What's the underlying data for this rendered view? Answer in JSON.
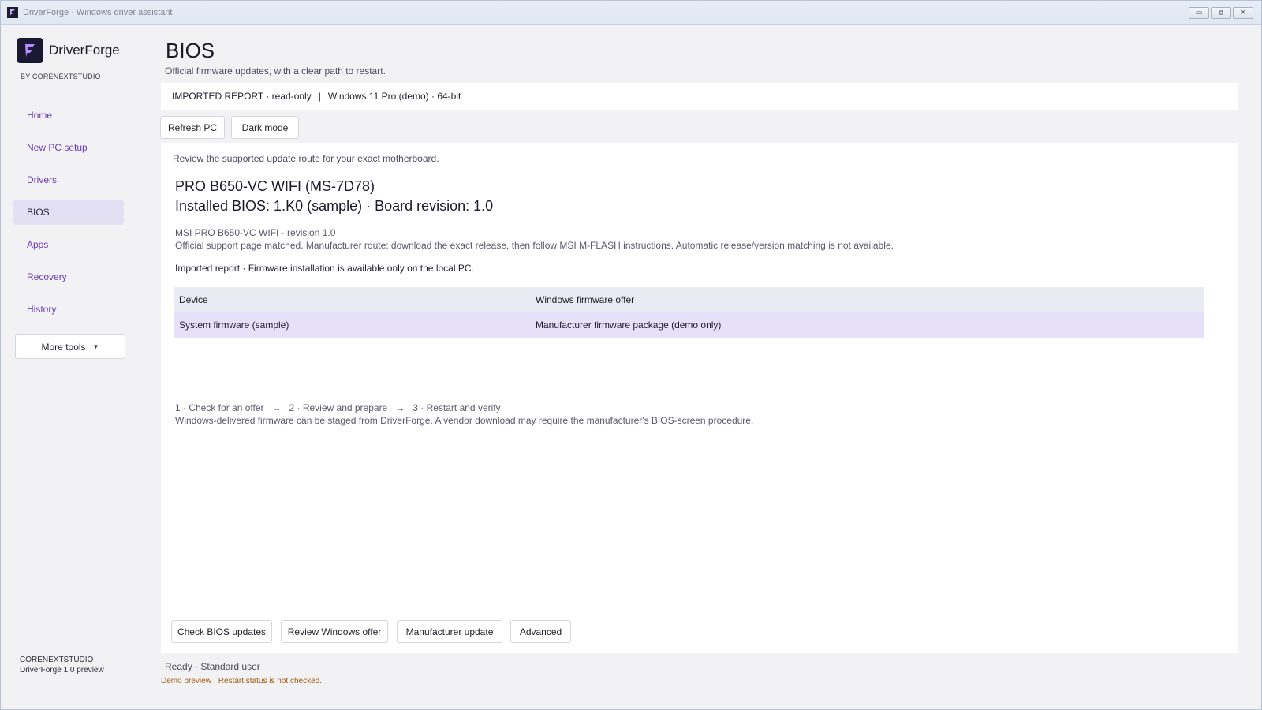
{
  "window": {
    "title": "DriverForge - Windows driver assistant",
    "controls": {
      "minimize": "▭",
      "maximize": "⧉",
      "close": "✕"
    }
  },
  "brand": {
    "name": "DriverForge",
    "by": "BY CORENEXTSTUDIO",
    "logo_color": "#1a1830",
    "logo_accent": "#b58cff"
  },
  "sidebar": {
    "items": [
      {
        "label": "Home",
        "active": false
      },
      {
        "label": "New PC setup",
        "active": false
      },
      {
        "label": "Drivers",
        "active": false
      },
      {
        "label": "BIOS",
        "active": true
      },
      {
        "label": "Apps",
        "active": false
      },
      {
        "label": "Recovery",
        "active": false
      },
      {
        "label": "History",
        "active": false
      }
    ],
    "more_tools": "More tools",
    "more_tools_caret": "▼",
    "footer_org": "CORENEXTSTUDIO",
    "footer_version": "DriverForge 1.0 preview"
  },
  "header": {
    "title": "BIOS",
    "subtitle": "Official firmware updates, with a clear path to restart."
  },
  "info_bar": {
    "report": "IMPORTED REPORT · read-only",
    "separator": "|",
    "os": "Windows 11 Pro (demo) · 64-bit"
  },
  "toolbar": {
    "refresh_label": "Refresh PC",
    "dark_mode_label": "Dark mode"
  },
  "panel": {
    "intro": "Review the supported update route for your exact motherboard.",
    "board_name": "PRO B650-VC WIFI (MS-7D78)",
    "bios_installed": "Installed BIOS: 1.K0 (sample) · Board revision: 1.0",
    "meta_model": "MSI PRO B650-VC WIFI · revision 1.0",
    "meta_support": "Official support page matched. Manufacturer route: download the exact release, then follow MSI M-FLASH instructions. Automatic release/version matching is not available.",
    "imported_note": "Imported report · Firmware installation is available only on the local PC.",
    "table": {
      "headers": [
        "Device",
        "Windows firmware offer"
      ],
      "rows": [
        [
          "System firmware (sample)",
          "Manufacturer firmware package (demo only)"
        ]
      ]
    },
    "steps": [
      "1 · Check for an offer",
      "2 · Review and prepare",
      "3 · Restart and verify"
    ],
    "step_arrow": "→",
    "steps_note": "Windows-delivered firmware can be staged from DriverForge. A vendor download may require the manufacturer's BIOS-screen procedure.",
    "actions": {
      "check": "Check BIOS updates",
      "review": "Review Windows offer",
      "manufacturer": "Manufacturer update",
      "advanced": "Advanced"
    }
  },
  "status": {
    "text": "Ready · Standard user",
    "demo_note": "Demo preview · Restart status is not checked."
  }
}
